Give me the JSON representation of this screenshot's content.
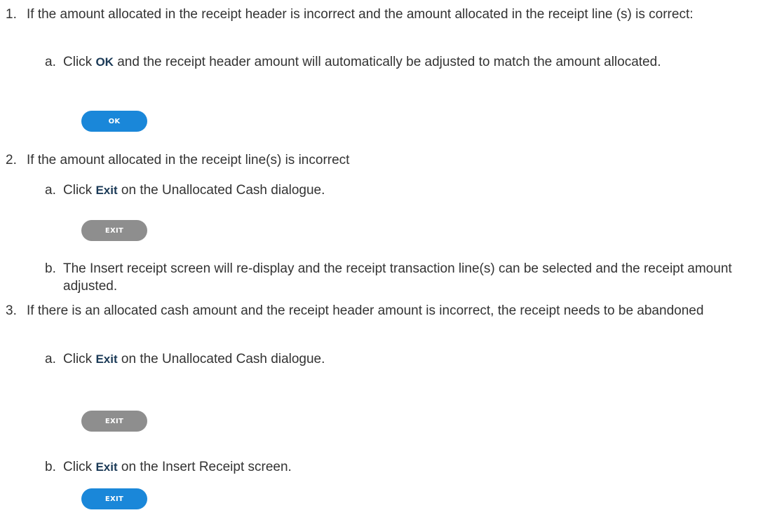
{
  "steps": [
    {
      "number": "1.",
      "text": "If the amount allocated in the receipt header is incorrect and the amount allocated in the receipt line (s) is correct:",
      "substeps": [
        {
          "letter": "a.",
          "pre": "Click ",
          "command": "OK",
          "post": " and the receipt header amount will automatically be adjusted to match the amount allocated.",
          "button": {
            "label": "OK",
            "color": "#1a87d9"
          }
        }
      ]
    },
    {
      "number": "2.",
      "text": "If the amount allocated in the receipt line(s) is incorrect",
      "substeps": [
        {
          "letter": "a.",
          "pre": "Click ",
          "command": "Exit",
          "post": " on the Unallocated Cash dialogue.",
          "button": {
            "label": "EXIT",
            "color": "#8e8e8e"
          }
        },
        {
          "letter": "b.",
          "text": "The Insert receipt screen will re-display and the receipt transaction line(s) can be selected and the receipt amount adjusted."
        }
      ]
    },
    {
      "number": "3.",
      "text": "If there is an allocated cash amount and the receipt header amount is incorrect, the receipt needs to be abandoned",
      "substeps": [
        {
          "letter": "a.",
          "pre": "Click ",
          "command": "Exit",
          "post": " on the Unallocated Cash dialogue.",
          "button": {
            "label": "EXIT",
            "color": "#8e8e8e"
          }
        },
        {
          "letter": "b.",
          "pre": "Click ",
          "command": "Exit",
          "post": " on the Insert Receipt screen.",
          "button": {
            "label": "EXIT",
            "color": "#1a87d9"
          }
        }
      ]
    }
  ]
}
